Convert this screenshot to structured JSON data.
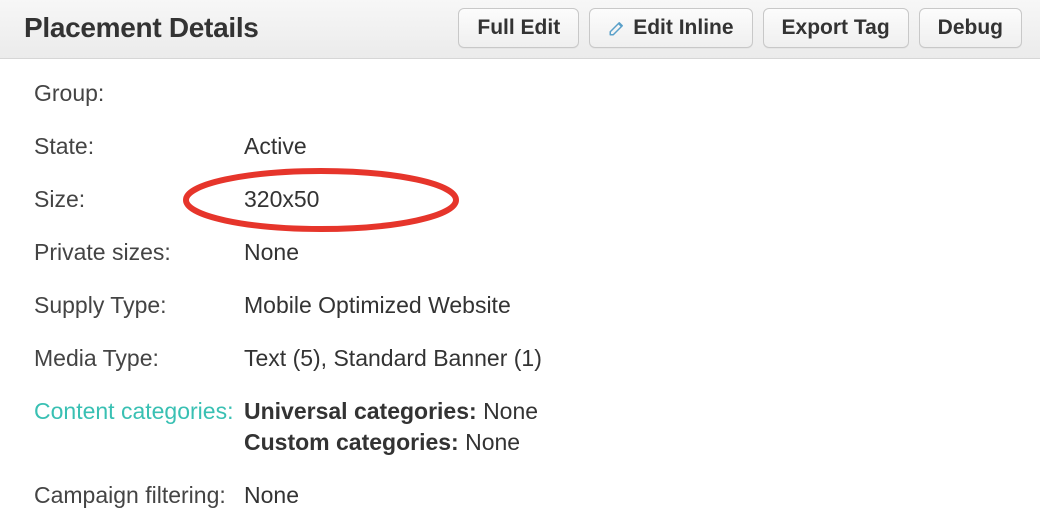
{
  "header": {
    "title": "Placement Details",
    "buttons": {
      "full_edit": "Full Edit",
      "edit_inline": "Edit Inline",
      "export_tag": "Export Tag",
      "debug": "Debug"
    }
  },
  "details": {
    "group": {
      "label": "Group:",
      "value": ""
    },
    "state": {
      "label": "State:",
      "value": "Active"
    },
    "size": {
      "label": "Size:",
      "value": "320x50"
    },
    "private_sizes": {
      "label": "Private sizes:",
      "value": "None"
    },
    "supply_type": {
      "label": "Supply Type:",
      "value": "Mobile Optimized Website"
    },
    "media_type": {
      "label": "Media Type:",
      "value": "Text (5), Standard Banner (1)"
    },
    "content_categories": {
      "label": "Content categories:",
      "universal_label": "Universal categories:",
      "universal_value": "None",
      "custom_label": "Custom categories:",
      "custom_value": "None"
    },
    "campaign_filtering": {
      "label": "Campaign filtering:",
      "value": "None"
    }
  }
}
